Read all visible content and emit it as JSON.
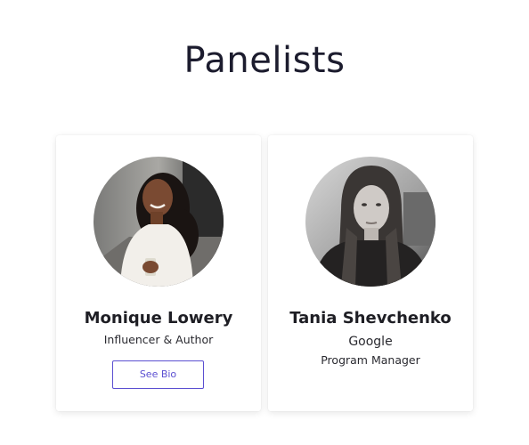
{
  "page": {
    "title": "Panelists"
  },
  "panelists": [
    {
      "name": "Monique Lowery",
      "subtitle": "Influencer & Author",
      "button_label": "See Bio"
    },
    {
      "name": "Tania Shevchenko",
      "company": "Google",
      "role": "Program Manager"
    }
  ],
  "colors": {
    "accent": "#5b4fd1",
    "title_text": "#1c1c2e",
    "body_text": "#2a2a30"
  }
}
